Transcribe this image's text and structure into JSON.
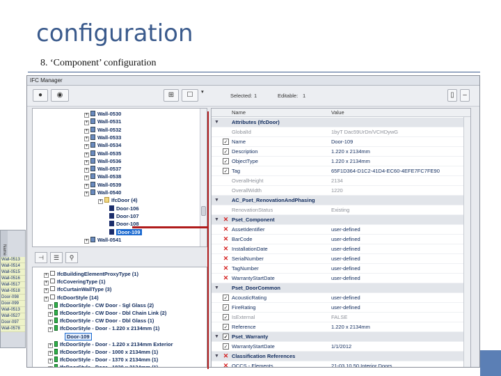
{
  "slide": {
    "title": "configuration",
    "subtitle": "8. ‘Component’ configuration"
  },
  "window": {
    "title": "IFC Manager",
    "toolbar": {
      "selected_label": "Selected:",
      "selected_value": "1",
      "editable_label": "Editable:",
      "editable_value": "1",
      "buttons": [
        "record-icon",
        "eye-icon",
        "structure-icon",
        "options-icon",
        "dropdown-icon",
        "panel-icon"
      ]
    },
    "tree": {
      "items": [
        {
          "label": "Wall-0530",
          "kind": "wall"
        },
        {
          "label": "Wall-0531",
          "kind": "wall"
        },
        {
          "label": "Wall-0532",
          "kind": "wall"
        },
        {
          "label": "Wall-0533",
          "kind": "wall"
        },
        {
          "label": "Wall-0534",
          "kind": "wall"
        },
        {
          "label": "Wall-0535",
          "kind": "wall"
        },
        {
          "label": "Wall-0536",
          "kind": "wall"
        },
        {
          "label": "Wall-0537",
          "kind": "wall"
        },
        {
          "label": "Wall-0538",
          "kind": "wall"
        },
        {
          "label": "Wall-0539",
          "kind": "wall"
        },
        {
          "label": "Wall-0540",
          "kind": "wall"
        },
        {
          "label": "IfcDoor (4)",
          "kind": "folder"
        },
        {
          "label": "Door-106",
          "kind": "door"
        },
        {
          "label": "Door-107",
          "kind": "door"
        },
        {
          "label": "Door-108",
          "kind": "door"
        },
        {
          "label": "Door-109",
          "kind": "door",
          "selected": true
        },
        {
          "label": "Wall-0541",
          "kind": "wall"
        }
      ]
    },
    "classification": {
      "items": [
        {
          "label": "IfcBuildingElementProxyType (1)",
          "kind": "type"
        },
        {
          "label": "IfcCoveringType (1)",
          "kind": "type"
        },
        {
          "label": "IfcCurtainWallType (3)",
          "kind": "type"
        },
        {
          "label": "IfcDoorStyle (14)",
          "kind": "type"
        },
        {
          "label": "IfcDoorStyle - CW Door - Sgl Glass (2)",
          "kind": "green"
        },
        {
          "label": "IfcDoorStyle - CW Door - Dbl Chain Link (2)",
          "kind": "green"
        },
        {
          "label": "IfcDoorStyle - CW Door - Dbl Glass (1)",
          "kind": "green"
        },
        {
          "label": "IfcDoorStyle - Door - 1.220 x 2134mm (1)",
          "kind": "green"
        },
        {
          "label": "Door-109",
          "kind": "door",
          "selected": true
        },
        {
          "label": "IfcDoorStyle - Door - 1.220 x 2134mm Exterior",
          "kind": "green"
        },
        {
          "label": "IfcDoorStyle - Door - 1000 x 2134mm (1)",
          "kind": "green"
        },
        {
          "label": "IfcDoorStyle - Door - 1370 x 2134mm (1)",
          "kind": "green"
        },
        {
          "label": "IfcDoorStyle - Door - 1830 x 2134mm (1)",
          "kind": "green"
        }
      ]
    },
    "strip": {
      "header": "Name",
      "items": [
        "Wall-0513",
        "Wall-0514",
        "Wall-0515",
        "Wall-0516",
        "Wall-0517",
        "Wall-0518",
        "Door-098",
        "Door-099",
        "Wall-0513",
        "Wall-0527",
        "Door-097",
        "Wall-0578"
      ]
    },
    "properties": {
      "col_name": "Name",
      "col_value": "Value",
      "rows": [
        {
          "type": "group",
          "name": "Attributes (IfcDoor)"
        },
        {
          "type": "prop",
          "mark": "none",
          "name": "GlobalId",
          "value": "1byT Dac59UrDn/VCHDywG",
          "dim": true
        },
        {
          "type": "prop",
          "mark": "check",
          "name": "Name",
          "value": "Door-109"
        },
        {
          "type": "prop",
          "mark": "check",
          "name": "Description",
          "value": "1.220 x 2134mm"
        },
        {
          "type": "prop",
          "mark": "check",
          "name": "ObjectType",
          "value": "1.220 x 2134mm"
        },
        {
          "type": "prop",
          "mark": "check",
          "name": "Tag",
          "value": "65F1D364-D1C2-41D4-EC60-4EFE7FC7FE90"
        },
        {
          "type": "prop",
          "mark": "none",
          "name": "OverallHeight",
          "value": "2134",
          "dim": true
        },
        {
          "type": "prop",
          "mark": "none",
          "name": "OverallWidth",
          "value": "1220",
          "dim": true
        },
        {
          "type": "group",
          "name": "AC_Pset_RenovationAndPhasing",
          "sub": true
        },
        {
          "type": "prop",
          "mark": "none",
          "name": "RenovationStatus",
          "value": "Existing",
          "dim": true
        },
        {
          "type": "group",
          "name": "Pset_Component",
          "mark": "x"
        },
        {
          "type": "prop",
          "mark": "x",
          "name": "AssetIdentifier",
          "value": "user-defined"
        },
        {
          "type": "prop",
          "mark": "x",
          "name": "BarCode",
          "value": "user-defined"
        },
        {
          "type": "prop",
          "mark": "x",
          "name": "InstallationDate",
          "value": "user-defined"
        },
        {
          "type": "prop",
          "mark": "x",
          "name": "SerialNumber",
          "value": "user-defined"
        },
        {
          "type": "prop",
          "mark": "x",
          "name": "TagNumber",
          "value": "user-defined"
        },
        {
          "type": "prop",
          "mark": "x",
          "name": "WarrantyStartDate",
          "value": "user-defined"
        },
        {
          "type": "group",
          "name": "Pset_DoorCommon",
          "sub": true
        },
        {
          "type": "prop",
          "mark": "check",
          "name": "AcousticRating",
          "value": "user-defined"
        },
        {
          "type": "prop",
          "mark": "check",
          "name": "FireRating",
          "value": "user-defined"
        },
        {
          "type": "prop",
          "mark": "check",
          "name": "IsExternal",
          "value": "FALSE",
          "dim": true
        },
        {
          "type": "prop",
          "mark": "check",
          "name": "Reference",
          "value": "1.220 x 2134mm"
        },
        {
          "type": "group",
          "name": "Pset_Warranty",
          "mark": "check"
        },
        {
          "type": "prop",
          "mark": "check",
          "name": "WarrantyStartDate",
          "value": "1/1/2012"
        },
        {
          "type": "group",
          "name": "Classification References",
          "mark": "x"
        },
        {
          "type": "prop",
          "mark": "x",
          "name": "OCCS - Elements",
          "value": "21-03 10 50 Interior Doors"
        }
      ]
    }
  },
  "colors": {
    "title": "#3a5a8c",
    "connector": "#b01b1b",
    "selection": "#1b6ad0"
  }
}
